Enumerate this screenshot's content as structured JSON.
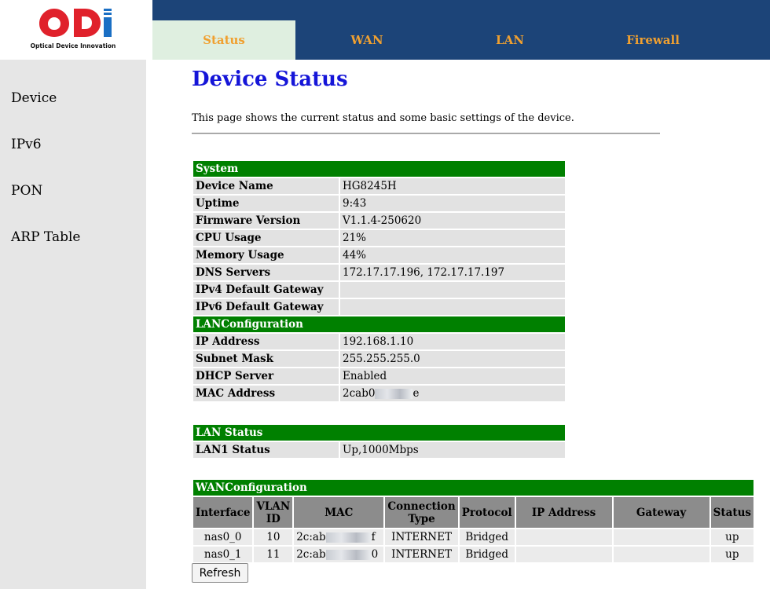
{
  "brand": {
    "tagline": "Optical Device Innovation",
    "logo_text": "ODI",
    "accent": "#e0212b",
    "blue": "#1a6fc4"
  },
  "tabs": [
    {
      "label": "Status",
      "active": true
    },
    {
      "label": "WAN",
      "active": false
    },
    {
      "label": "LAN",
      "active": false
    },
    {
      "label": "Firewall",
      "active": false
    }
  ],
  "sidebar": {
    "items": [
      "Device",
      "IPv6",
      "PON",
      "ARP Table"
    ]
  },
  "page": {
    "title": "Device Status",
    "intro": "This page shows the current status and some basic settings of the device."
  },
  "system": {
    "header": "System",
    "rows": [
      {
        "label": "Device Name",
        "value": "HG8245H"
      },
      {
        "label": "Uptime",
        "value": "9:43"
      },
      {
        "label": "Firmware Version",
        "value": "V1.1.4-250620"
      },
      {
        "label": "CPU Usage",
        "value": "21%"
      },
      {
        "label": "Memory Usage",
        "value": "44%"
      },
      {
        "label": "DNS Servers",
        "value": "172.17.17.196, 172.17.17.197"
      },
      {
        "label": "IPv4 Default Gateway",
        "value": ""
      },
      {
        "label": "IPv6 Default Gateway",
        "value": ""
      }
    ]
  },
  "lan_config": {
    "header": "LANConfiguration",
    "rows": [
      {
        "label": "IP Address",
        "value": "192.168.1.10"
      },
      {
        "label": "Subnet Mask",
        "value": "255.255.255.0"
      },
      {
        "label": "DHCP Server",
        "value": "Enabled"
      }
    ],
    "mac_label": "MAC Address",
    "mac_prefix": "2cab0",
    "mac_suffix": "e"
  },
  "lan_status": {
    "header": "LAN Status",
    "rows": [
      {
        "label": "LAN1 Status",
        "value": "Up,1000Mbps"
      }
    ]
  },
  "wan_config": {
    "header": "WANConfiguration",
    "columns": [
      "Interface",
      "VLAN ID",
      "MAC",
      "Connection Type",
      "Protocol",
      "IP Address",
      "Gateway",
      "Status"
    ],
    "rows": [
      {
        "interface": "nas0_0",
        "vlan": "10",
        "mac_prefix": "2c:ab",
        "mac_suffix": "f",
        "type": "INTERNET",
        "protocol": "Bridged",
        "ip": "",
        "gateway": "",
        "status": "up"
      },
      {
        "interface": "nas0_1",
        "vlan": "11",
        "mac_prefix": "2c:ab",
        "mac_suffix": "0",
        "type": "INTERNET",
        "protocol": "Bridged",
        "ip": "",
        "gateway": "",
        "status": "up"
      }
    ]
  },
  "refresh_label": "Refresh"
}
